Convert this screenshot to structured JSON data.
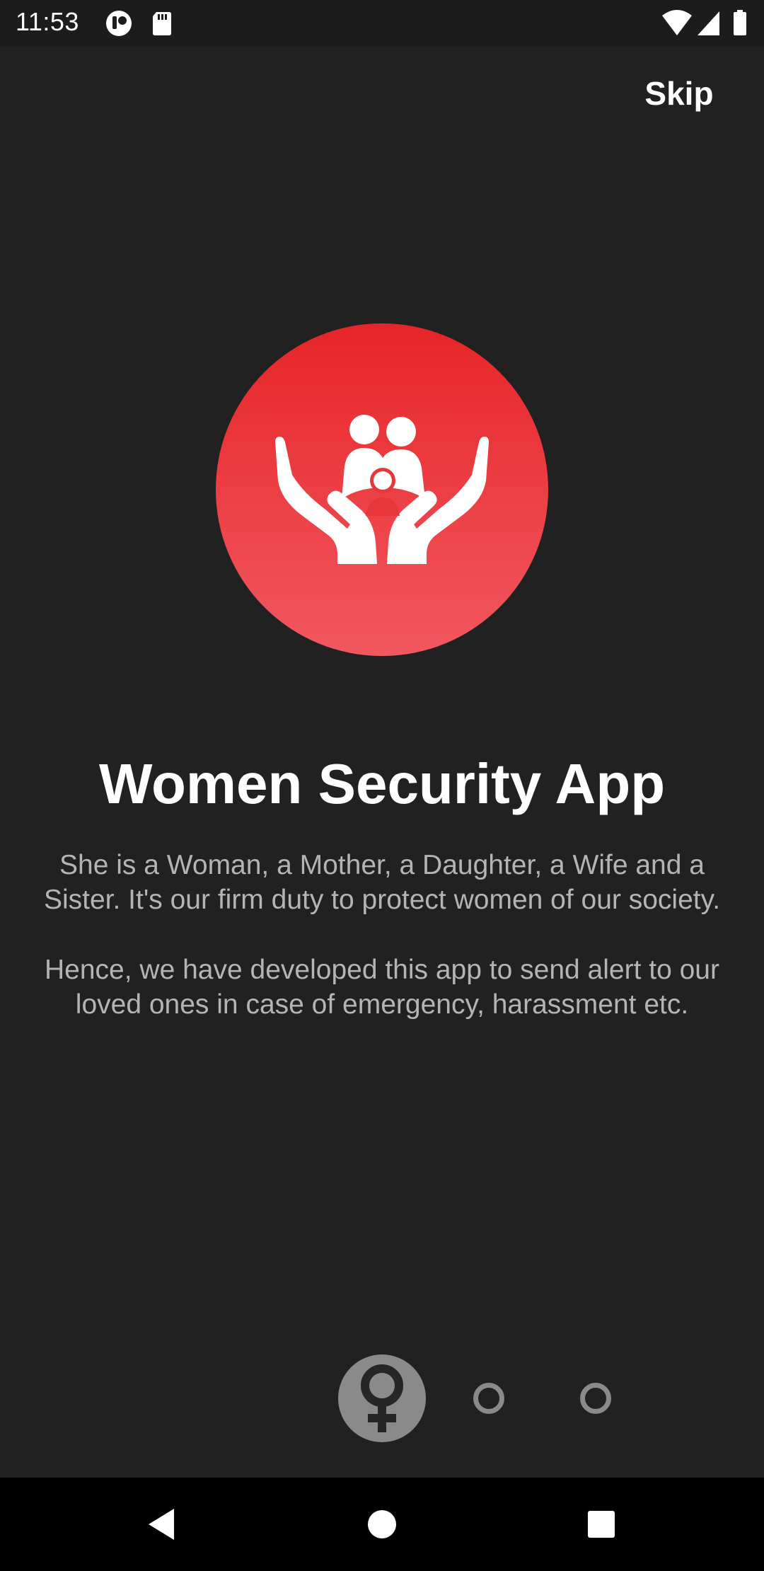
{
  "status_bar": {
    "time": "11:53",
    "icons": [
      "app-notification-icon",
      "sd-card-icon",
      "wifi-icon",
      "signal-icon",
      "battery-icon"
    ]
  },
  "header": {
    "skip_label": "Skip"
  },
  "main": {
    "logo_icon": "hands-protecting-family-icon",
    "title": "Women Security App",
    "paragraph1_line1": "She is a Woman, a Mother, a Daughter, a Wife and a",
    "paragraph1_line2": "Sister. It's our firm duty to protect women of our society.",
    "paragraph2_line1": "Hence, we have developed this app to send alert to our",
    "paragraph2_line2": "loved ones in case of emergency, harassment etc."
  },
  "pager": {
    "total_pages": 3,
    "current_page": 1,
    "active_icon": "female-symbol-icon"
  },
  "navigation": {
    "buttons": [
      "back-icon",
      "home-icon",
      "recents-icon"
    ]
  },
  "colors": {
    "background": "#212121",
    "accent_red_top": "#e62528",
    "accent_red_bottom": "#f25860",
    "text_primary": "#ffffff",
    "text_secondary": "#b4b4b4",
    "indicator": "#8a8a8a"
  }
}
